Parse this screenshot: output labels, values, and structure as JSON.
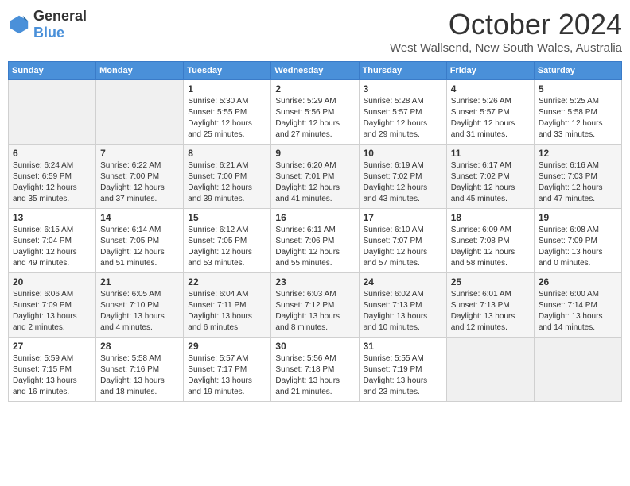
{
  "header": {
    "logo": {
      "general": "General",
      "blue": "Blue"
    },
    "title": "October 2024",
    "location": "West Wallsend, New South Wales, Australia"
  },
  "days_of_week": [
    "Sunday",
    "Monday",
    "Tuesday",
    "Wednesday",
    "Thursday",
    "Friday",
    "Saturday"
  ],
  "weeks": [
    [
      {
        "day": "",
        "info": ""
      },
      {
        "day": "",
        "info": ""
      },
      {
        "day": "1",
        "info": "Sunrise: 5:30 AM\nSunset: 5:55 PM\nDaylight: 12 hours\nand 25 minutes."
      },
      {
        "day": "2",
        "info": "Sunrise: 5:29 AM\nSunset: 5:56 PM\nDaylight: 12 hours\nand 27 minutes."
      },
      {
        "day": "3",
        "info": "Sunrise: 5:28 AM\nSunset: 5:57 PM\nDaylight: 12 hours\nand 29 minutes."
      },
      {
        "day": "4",
        "info": "Sunrise: 5:26 AM\nSunset: 5:57 PM\nDaylight: 12 hours\nand 31 minutes."
      },
      {
        "day": "5",
        "info": "Sunrise: 5:25 AM\nSunset: 5:58 PM\nDaylight: 12 hours\nand 33 minutes."
      }
    ],
    [
      {
        "day": "6",
        "info": "Sunrise: 6:24 AM\nSunset: 6:59 PM\nDaylight: 12 hours\nand 35 minutes."
      },
      {
        "day": "7",
        "info": "Sunrise: 6:22 AM\nSunset: 7:00 PM\nDaylight: 12 hours\nand 37 minutes."
      },
      {
        "day": "8",
        "info": "Sunrise: 6:21 AM\nSunset: 7:00 PM\nDaylight: 12 hours\nand 39 minutes."
      },
      {
        "day": "9",
        "info": "Sunrise: 6:20 AM\nSunset: 7:01 PM\nDaylight: 12 hours\nand 41 minutes."
      },
      {
        "day": "10",
        "info": "Sunrise: 6:19 AM\nSunset: 7:02 PM\nDaylight: 12 hours\nand 43 minutes."
      },
      {
        "day": "11",
        "info": "Sunrise: 6:17 AM\nSunset: 7:02 PM\nDaylight: 12 hours\nand 45 minutes."
      },
      {
        "day": "12",
        "info": "Sunrise: 6:16 AM\nSunset: 7:03 PM\nDaylight: 12 hours\nand 47 minutes."
      }
    ],
    [
      {
        "day": "13",
        "info": "Sunrise: 6:15 AM\nSunset: 7:04 PM\nDaylight: 12 hours\nand 49 minutes."
      },
      {
        "day": "14",
        "info": "Sunrise: 6:14 AM\nSunset: 7:05 PM\nDaylight: 12 hours\nand 51 minutes."
      },
      {
        "day": "15",
        "info": "Sunrise: 6:12 AM\nSunset: 7:05 PM\nDaylight: 12 hours\nand 53 minutes."
      },
      {
        "day": "16",
        "info": "Sunrise: 6:11 AM\nSunset: 7:06 PM\nDaylight: 12 hours\nand 55 minutes."
      },
      {
        "day": "17",
        "info": "Sunrise: 6:10 AM\nSunset: 7:07 PM\nDaylight: 12 hours\nand 57 minutes."
      },
      {
        "day": "18",
        "info": "Sunrise: 6:09 AM\nSunset: 7:08 PM\nDaylight: 12 hours\nand 58 minutes."
      },
      {
        "day": "19",
        "info": "Sunrise: 6:08 AM\nSunset: 7:09 PM\nDaylight: 13 hours\nand 0 minutes."
      }
    ],
    [
      {
        "day": "20",
        "info": "Sunrise: 6:06 AM\nSunset: 7:09 PM\nDaylight: 13 hours\nand 2 minutes."
      },
      {
        "day": "21",
        "info": "Sunrise: 6:05 AM\nSunset: 7:10 PM\nDaylight: 13 hours\nand 4 minutes."
      },
      {
        "day": "22",
        "info": "Sunrise: 6:04 AM\nSunset: 7:11 PM\nDaylight: 13 hours\nand 6 minutes."
      },
      {
        "day": "23",
        "info": "Sunrise: 6:03 AM\nSunset: 7:12 PM\nDaylight: 13 hours\nand 8 minutes."
      },
      {
        "day": "24",
        "info": "Sunrise: 6:02 AM\nSunset: 7:13 PM\nDaylight: 13 hours\nand 10 minutes."
      },
      {
        "day": "25",
        "info": "Sunrise: 6:01 AM\nSunset: 7:13 PM\nDaylight: 13 hours\nand 12 minutes."
      },
      {
        "day": "26",
        "info": "Sunrise: 6:00 AM\nSunset: 7:14 PM\nDaylight: 13 hours\nand 14 minutes."
      }
    ],
    [
      {
        "day": "27",
        "info": "Sunrise: 5:59 AM\nSunset: 7:15 PM\nDaylight: 13 hours\nand 16 minutes."
      },
      {
        "day": "28",
        "info": "Sunrise: 5:58 AM\nSunset: 7:16 PM\nDaylight: 13 hours\nand 18 minutes."
      },
      {
        "day": "29",
        "info": "Sunrise: 5:57 AM\nSunset: 7:17 PM\nDaylight: 13 hours\nand 19 minutes."
      },
      {
        "day": "30",
        "info": "Sunrise: 5:56 AM\nSunset: 7:18 PM\nDaylight: 13 hours\nand 21 minutes."
      },
      {
        "day": "31",
        "info": "Sunrise: 5:55 AM\nSunset: 7:19 PM\nDaylight: 13 hours\nand 23 minutes."
      },
      {
        "day": "",
        "info": ""
      },
      {
        "day": "",
        "info": ""
      }
    ]
  ]
}
